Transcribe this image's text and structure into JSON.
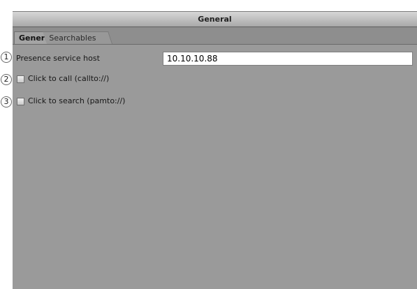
{
  "window": {
    "title": "General"
  },
  "tabs": [
    {
      "label": "General",
      "selected": true
    },
    {
      "label": "Searchables",
      "selected": false
    }
  ],
  "settings": {
    "presence_label": "Presence service host",
    "presence_value": "10.10.10.88",
    "click_to_call_label": "Click to call (callto://)",
    "click_to_call_checked": false,
    "click_to_search_label": "Click to search (pamto://)",
    "click_to_search_checked": false
  },
  "markers": [
    "1",
    "2",
    "3"
  ]
}
